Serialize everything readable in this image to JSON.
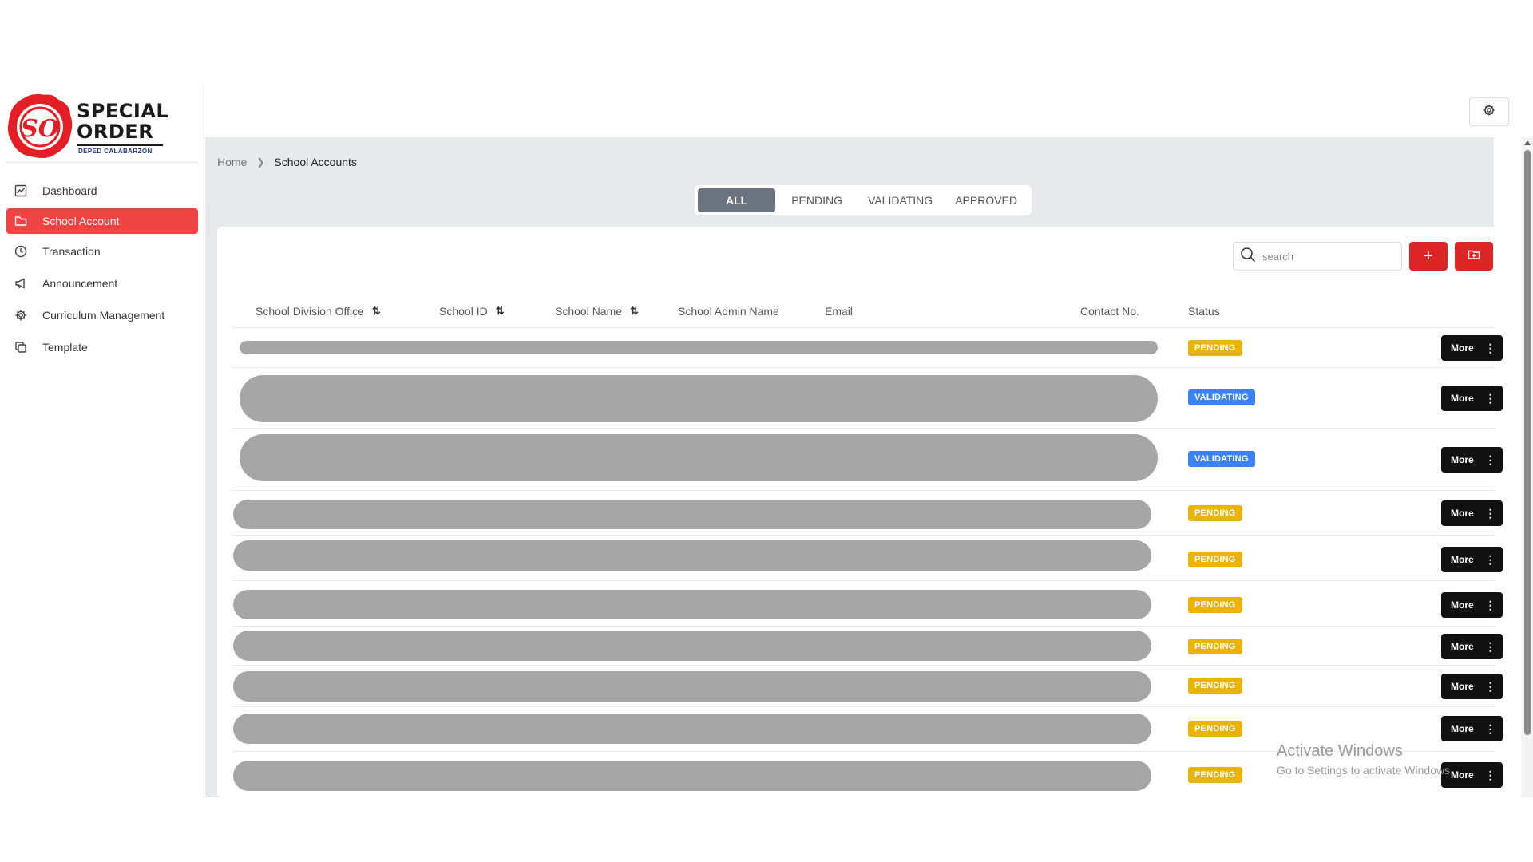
{
  "app": {
    "logo_title_line1": "SPECIAL",
    "logo_title_line2": "ORDER",
    "logo_subtitle": "DEPED CALABARZON",
    "logo_seal_letters": "SO"
  },
  "sidebar": {
    "items": [
      {
        "label": "Dashboard",
        "icon": "chart-icon",
        "active": false
      },
      {
        "label": "School Account",
        "icon": "folder-icon",
        "active": true
      },
      {
        "label": "Transaction",
        "icon": "clock-icon",
        "active": false
      },
      {
        "label": "Announcement",
        "icon": "megaphone-icon",
        "active": false
      },
      {
        "label": "Curriculum Management",
        "icon": "gear-icon",
        "active": false
      },
      {
        "label": "Template",
        "icon": "copy-icon",
        "active": false
      }
    ]
  },
  "topbar": {
    "settings_icon": "gear-icon"
  },
  "breadcrumb": {
    "home": "Home",
    "current": "School Accounts"
  },
  "tabs": [
    "ALL",
    "PENDING",
    "VALIDATING",
    "APPROVED"
  ],
  "active_tab": "ALL",
  "search": {
    "placeholder": "search",
    "value": ""
  },
  "actions": {
    "add_label": "+",
    "export_icon": "folder-icon"
  },
  "table": {
    "columns": [
      {
        "label": "School Division Office",
        "sort": "⇅"
      },
      {
        "label": "School ID",
        "sort": "⇅"
      },
      {
        "label": "School Name",
        "sort": "⇅"
      },
      {
        "label": "School Admin Name"
      },
      {
        "label": "Email"
      },
      {
        "label": "Contact No."
      },
      {
        "label": "Status"
      }
    ],
    "rows": [
      {
        "status": "PENDING",
        "action": "More"
      },
      {
        "status": "VALIDATING",
        "action": "More"
      },
      {
        "status": "VALIDATING",
        "action": "More"
      },
      {
        "status": "PENDING",
        "action": "More"
      },
      {
        "status": "PENDING",
        "action": "More"
      },
      {
        "status": "PENDING",
        "action": "More"
      },
      {
        "status": "PENDING",
        "action": "More"
      },
      {
        "status": "PENDING",
        "action": "More"
      },
      {
        "status": "PENDING",
        "action": "More"
      },
      {
        "status": "PENDING",
        "action": "More"
      }
    ]
  },
  "colors": {
    "accent": "#ef4444",
    "pending": "#eab308",
    "validating": "#3b82f6",
    "more_button": "#111111"
  },
  "watermark": {
    "line1": "Activate Windows",
    "line2": "Go to Settings to activate Windows."
  }
}
